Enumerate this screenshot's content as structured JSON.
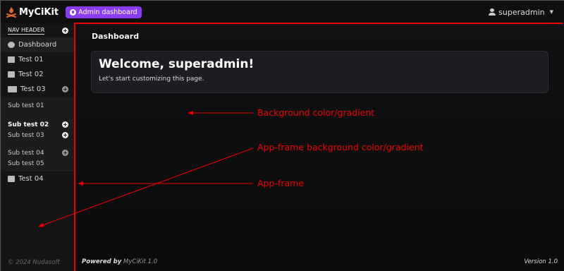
{
  "header": {
    "brand": "MyCiKit",
    "admin_label": "Admin dashboard",
    "user": "superadmin"
  },
  "sidebar": {
    "nav_header": "NAV HEADER",
    "items": [
      {
        "label": "Dashboard",
        "icon": "dashboard-icon"
      },
      {
        "label": "Test 01",
        "icon": "cart-icon"
      },
      {
        "label": "Test 02",
        "icon": "id-card-icon"
      },
      {
        "label": "Test 03",
        "icon": "users-icon"
      }
    ],
    "subitems": [
      {
        "label": "Sub test 01"
      },
      {
        "label": "Sub test 02"
      },
      {
        "label": "Sub test 03"
      },
      {
        "label": "Sub test 04"
      },
      {
        "label": "Sub test 05"
      }
    ],
    "last_item": {
      "label": "Test 04",
      "icon": "card-icon"
    },
    "copyright": "© 2024 Nudasoft"
  },
  "main": {
    "page_title": "Dashboard",
    "welcome_title": "Welcome, superadmin!",
    "welcome_text": "Let's start customizing this page.",
    "footer_prefix": "Powered by",
    "footer_product": "MyCiKit 1.0",
    "version": "Version 1.0"
  },
  "annotations": {
    "background": "Background color/gradient",
    "app_frame_bg": "App-frame background color/gradient",
    "app_frame": "App-frame"
  },
  "colors": {
    "accent": "#8a3df0",
    "annotation": "#ee0000",
    "brand_logo": "#e8622c"
  }
}
